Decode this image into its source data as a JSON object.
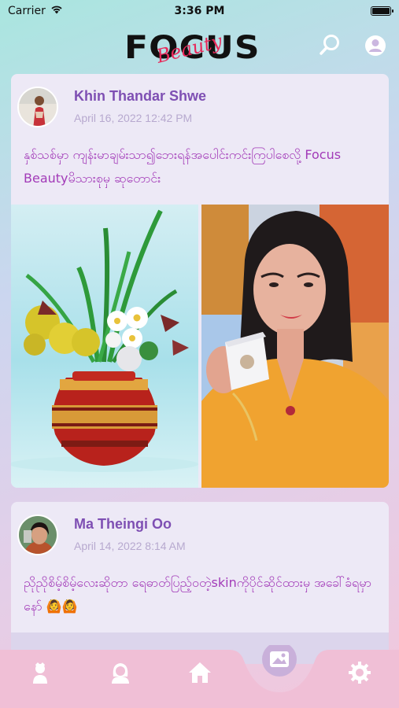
{
  "status_bar": {
    "carrier": "Carrier",
    "time": "3:36 PM"
  },
  "header": {
    "logo_main": "FOCUS",
    "logo_script": "Beauty"
  },
  "icons": {
    "search": "search-icon",
    "profile": "person-icon",
    "tab1": "beauty-contest-icon",
    "tab2": "stylist-icon",
    "tab3": "home-icon",
    "tab4": "gallery-icon",
    "tab5": "gear-icon"
  },
  "colors": {
    "accent_purple": "#7e4fb3",
    "post_text": "#a23ab8",
    "nav_pink": "#f0bfd6",
    "nav_active_circle": "#c9b0da"
  },
  "posts": [
    {
      "author": "Khin Thandar Shwe",
      "date": "April 16, 2022 12:42 PM",
      "text": "နှစ်သစ်မှာ ကျန်းမာချမ်းသာ၍ဘေးရန်အပေါင်းကင်းကြပါစေလို့ Focus Beautyမိသားစုမှ ဆုတောင်း"
    },
    {
      "author": "Ma Theingi Oo",
      "date": "April 14, 2022 8:14 AM",
      "text": "ညိုညိုစိမ့်စိမ့်လေးဆိုတာ ရေဓာတ်ပြည့်ဝတဲ့skinကိုပိုင်ဆိုင်ထားမှ အခေါ်ခံရမှာနော် 🙆🙆"
    }
  ]
}
